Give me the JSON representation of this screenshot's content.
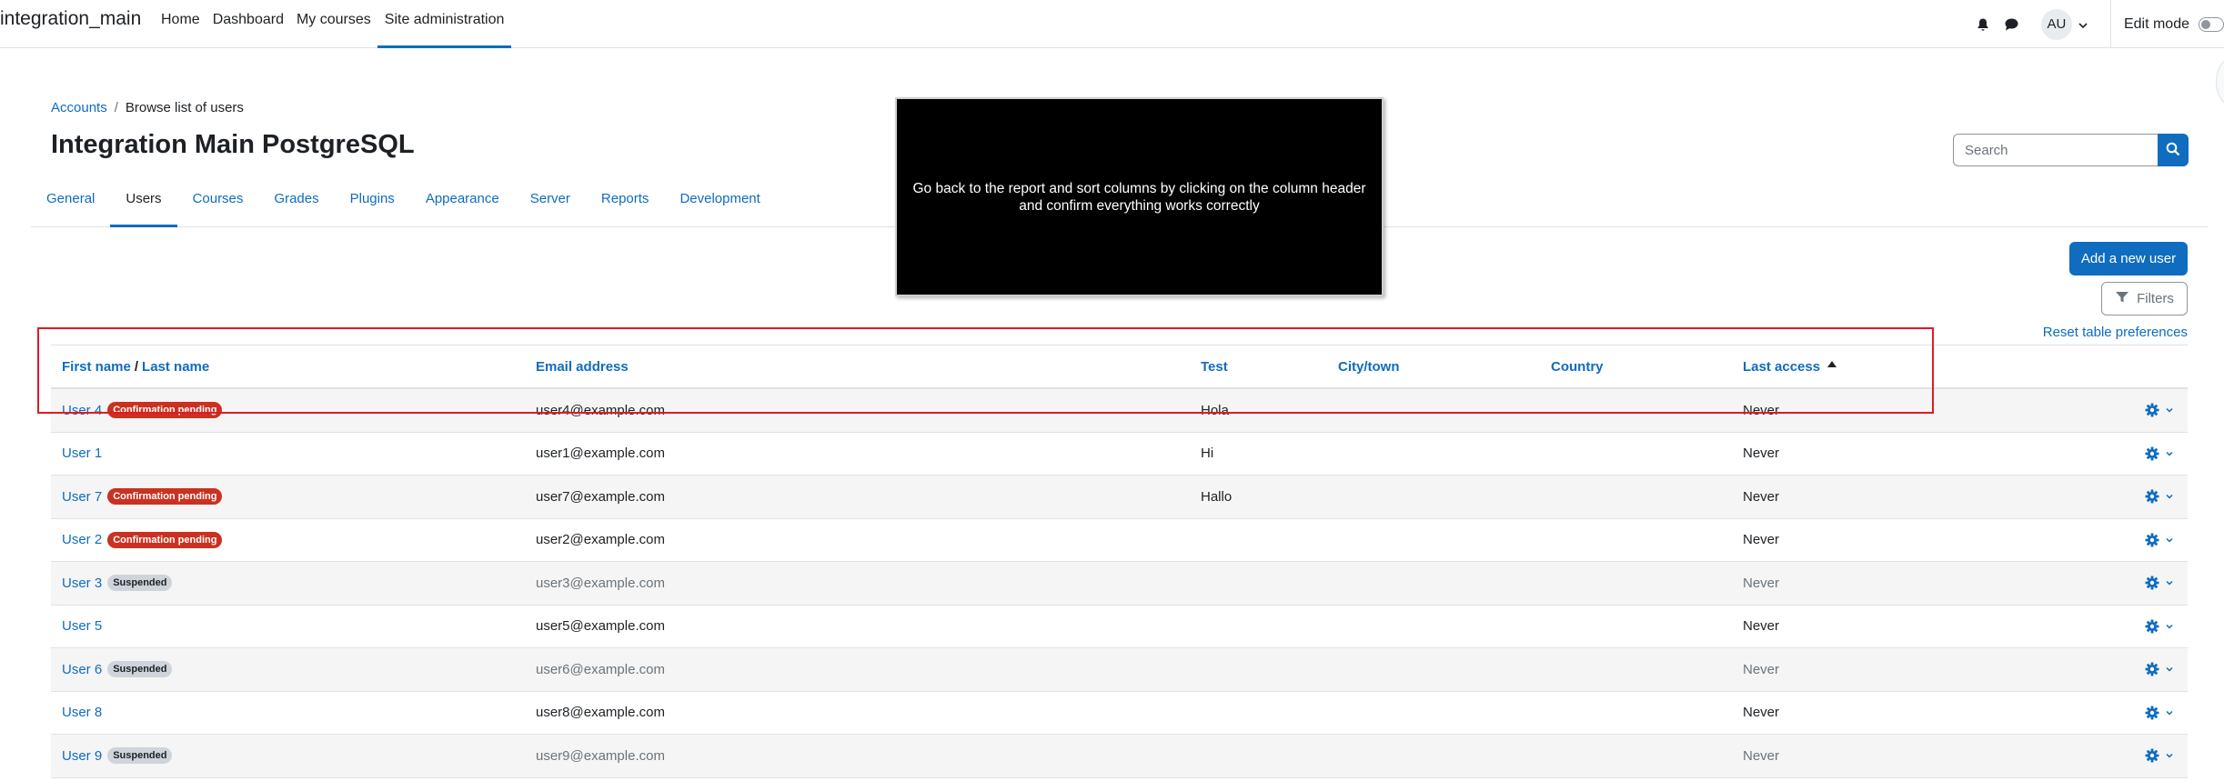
{
  "navbar": {
    "brand": "integration_main",
    "items": [
      {
        "label": "Home"
      },
      {
        "label": "Dashboard"
      },
      {
        "label": "My courses"
      },
      {
        "label": "Site administration"
      }
    ],
    "avatar_initials": "AU",
    "edit_mode_label": "Edit mode"
  },
  "breadcrumb": {
    "parent": "Accounts",
    "separator": "/",
    "current": "Browse list of users"
  },
  "page_title": "Integration Main PostgreSQL",
  "search": {
    "placeholder": "Search"
  },
  "secondary_nav": {
    "tabs": [
      {
        "label": "General"
      },
      {
        "label": "Users"
      },
      {
        "label": "Courses"
      },
      {
        "label": "Grades"
      },
      {
        "label": "Plugins"
      },
      {
        "label": "Appearance"
      },
      {
        "label": "Server"
      },
      {
        "label": "Reports"
      },
      {
        "label": "Development"
      }
    ],
    "active": "Users"
  },
  "overlay": {
    "text": "Go back to the report and sort columns by clicking on the column header\nand confirm everything works correctly"
  },
  "actions": {
    "add_user": "Add a new user",
    "filters": "Filters",
    "reset_prefs": "Reset table preferences"
  },
  "table": {
    "headers": {
      "first_name": "First name",
      "slash": "/",
      "last_name": "Last name",
      "email": "Email address",
      "test": "Test",
      "city": "City/town",
      "country": "Country",
      "last_access": "Last access"
    },
    "rows": [
      {
        "name": "User 4",
        "badge": "Confirmation pending",
        "email": "user4@example.com",
        "test": "Hola",
        "city": "",
        "country": "",
        "last_access": "Never"
      },
      {
        "name": "User 1",
        "badge": "",
        "email": "user1@example.com",
        "test": "Hi",
        "city": "",
        "country": "",
        "last_access": "Never"
      },
      {
        "name": "User 7",
        "badge": "Confirmation pending",
        "email": "user7@example.com",
        "test": "Hallo",
        "city": "",
        "country": "",
        "last_access": "Never"
      },
      {
        "name": "User 2",
        "badge": "Confirmation pending",
        "email": "user2@example.com",
        "test": "",
        "city": "",
        "country": "",
        "last_access": "Never"
      },
      {
        "name": "User 3",
        "badge": "Suspended",
        "email": "user3@example.com",
        "test": "",
        "city": "",
        "country": "",
        "last_access": "Never"
      },
      {
        "name": "User 5",
        "badge": "",
        "email": "user5@example.com",
        "test": "",
        "city": "",
        "country": "",
        "last_access": "Never"
      },
      {
        "name": "User 6",
        "badge": "Suspended",
        "email": "user6@example.com",
        "test": "",
        "city": "",
        "country": "",
        "last_access": "Never"
      },
      {
        "name": "User 8",
        "badge": "",
        "email": "user8@example.com",
        "test": "",
        "city": "",
        "country": "",
        "last_access": "Never"
      },
      {
        "name": "User 9",
        "badge": "Suspended",
        "email": "user9@example.com",
        "test": "",
        "city": "",
        "country": "",
        "last_access": "Never"
      }
    ]
  },
  "colors": {
    "brand": "#0f6cbf",
    "pending": "#ca3120",
    "suspended": "#ced4da",
    "highlight": "#e01b24"
  }
}
